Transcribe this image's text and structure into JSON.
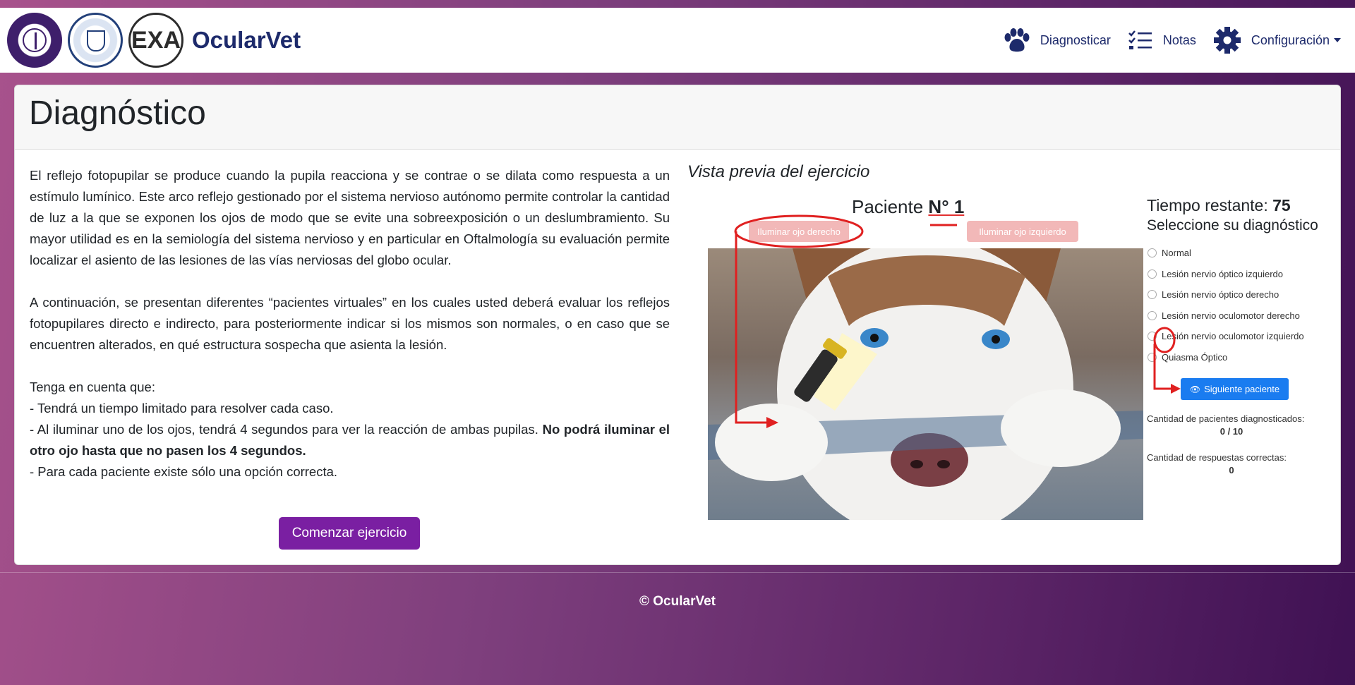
{
  "brand": {
    "name": "OcularVet",
    "logo_text_1": "EXA"
  },
  "nav": {
    "diagnose": "Diagnosticar",
    "notes": "Notas",
    "settings": "Configuración"
  },
  "page_title": "Diagnóstico",
  "intro": {
    "p1": "El reflejo fotopupilar se produce cuando la pupila reacciona y se contrae o se dilata como respuesta a un estímulo lumínico. Este arco reflejo gestionado por el sistema nervioso autónomo permite controlar la cantidad de luz a la que se exponen los ojos de modo que se evite una sobreexposición o un deslumbramiento. Su mayor utilidad es en la semiología del sistema nervioso y en particular en Oftalmología su evaluación permite localizar el asiento de las lesiones de las vías nerviosas del globo ocular.",
    "p2": "A continuación, se presentan diferentes “pacientes virtuales” en los cuales usted deberá evaluar los reflejos fotopupilares directo e indirecto, para posteriormente indicar si los mismos son normales, o en caso que se encuentren alterados, en qué estructura sospecha que asienta la lesión.",
    "tips_title": "Tenga en cuenta que:",
    "tip1": "- Tendrá un tiempo limitado para resolver cada caso.",
    "tip2_a": "- Al iluminar uno de los ojos, tendrá 4 segundos para ver la reacción de ambas pupilas.",
    "tip2_b": "No podrá iluminar el otro ojo hasta que no pasen los 4 segundos.",
    "tip3": "- Para cada paciente existe sólo una opción correcta."
  },
  "start_button": "Comenzar ejercicio",
  "preview": {
    "title": "Vista previa del ejercicio",
    "patient_label": "Paciente",
    "patient_number": "N° 1",
    "btn_right_eye": "Iluminar ojo derecho",
    "btn_left_eye": "Iluminar ojo izquierdo",
    "time_label": "Tiempo restante:",
    "time_value": "75",
    "select_title": "Seleccione su diagnóstico",
    "options": [
      "Normal",
      "Lesión nervio óptico izquierdo",
      "Lesión nervio óptico derecho",
      "Lesión nervio oculomotor derecho",
      "Lesión nervio oculomotor izquierdo",
      "Quiasma Óptico"
    ],
    "next_button": "Siguiente paciente",
    "diagnosed_label": "Cantidad de pacientes diagnosticados:",
    "diagnosed_value": "0 / 10",
    "correct_label": "Cantidad de respuestas correctas:",
    "correct_value": "0"
  },
  "footer": "© OcularVet",
  "colors": {
    "primary_purple": "#7a1fa2",
    "navy": "#1d2a6b",
    "next_blue": "#1a7cf0",
    "annotation_red": "#e02020"
  }
}
